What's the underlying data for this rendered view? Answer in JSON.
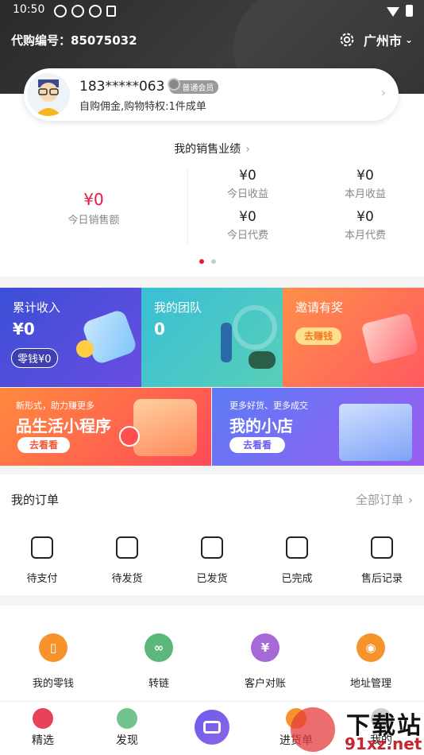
{
  "status_bar": {
    "time": "10:50"
  },
  "header": {
    "code_label": "代购编号：",
    "code_value": "85075032",
    "city": "广州市"
  },
  "user": {
    "phone": "183*****063",
    "level": "普通会员",
    "desc": "自购佣金,购物特权:1件成单"
  },
  "sales": {
    "title": "我的销售业绩",
    "today_sales": {
      "value": "¥0",
      "label": "今日销售额"
    },
    "stats": [
      {
        "value": "¥0",
        "label": "今日收益"
      },
      {
        "value": "¥0",
        "label": "本月收益"
      },
      {
        "value": "¥0",
        "label": "今日代费"
      },
      {
        "value": "¥0",
        "label": "本月代费"
      }
    ]
  },
  "tiles": {
    "income": {
      "title": "累计收入",
      "value": "¥0",
      "badge": "零钱¥0"
    },
    "team": {
      "title": "我的团队",
      "value": "0"
    },
    "invite": {
      "title": "邀请有奖",
      "button": "去赚钱"
    },
    "mini": {
      "sub": "新形式，助力赚更多",
      "title": "品生活小程序",
      "button": "去看看"
    },
    "shop": {
      "sub": "更多好货、更多成交",
      "title": "我的小店",
      "button": "去看看"
    }
  },
  "orders": {
    "title": "我的订单",
    "all": "全部订单",
    "items": [
      "待支付",
      "待发货",
      "已发货",
      "已完成",
      "售后记录"
    ]
  },
  "tools": {
    "items": [
      {
        "label": "我的零钱",
        "icon": "wallet-icon",
        "color": "#f7932b"
      },
      {
        "label": "转链",
        "icon": "link-icon",
        "color": "#5cb87a"
      },
      {
        "label": "客户对账",
        "icon": "bill-icon",
        "color": "#a569d8"
      },
      {
        "label": "地址管理",
        "icon": "location-icon",
        "color": "#f7932b"
      }
    ]
  },
  "nav": {
    "items": [
      "精选",
      "发现",
      "",
      "进货单",
      "我的"
    ]
  },
  "watermark": {
    "text": "下载站",
    "domain": "91xz.net"
  }
}
